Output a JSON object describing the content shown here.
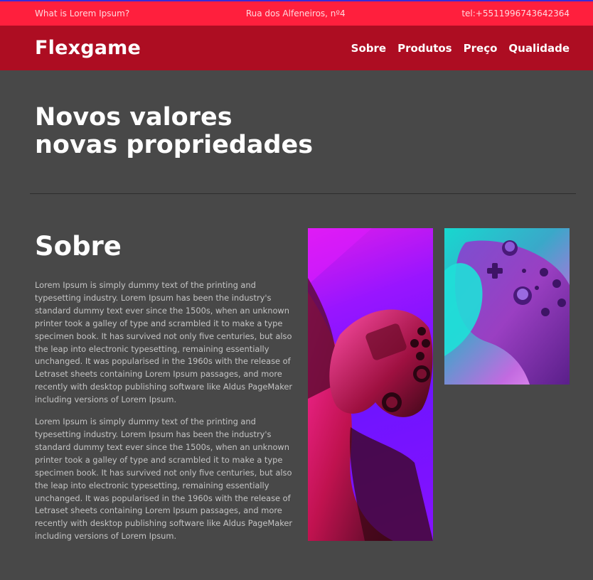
{
  "topbar": {
    "question": "What is Lorem Ipsum?",
    "address": "Rua dos Alfeneiros, nº4",
    "phone": "tel:+5511996743642364"
  },
  "navbar": {
    "brand": "Flexgame",
    "links": [
      "Sobre",
      "Produtos",
      "Preço",
      "Qualidade"
    ]
  },
  "hero": {
    "line1": "Novos valores",
    "line2": "novas propriedades"
  },
  "about": {
    "title": "Sobre",
    "paragraphs": [
      "Lorem Ipsum is simply dummy text of the printing and typesetting industry. Lorem Ipsum has been the industry's standard dummy text ever since the 1500s, when an unknown printer took a galley of type and scrambled it to make a type specimen book. It has survived not only five centuries, but also the leap into electronic typesetting, remaining essentially unchanged. It was popularised in the 1960s with the release of Letraset sheets containing Lorem Ipsum passages, and more recently with desktop publishing software like Aldus PageMaker including versions of Lorem Ipsum.",
      "Lorem Ipsum is simply dummy text of the printing and typesetting industry. Lorem Ipsum has been the industry's standard dummy text ever since the 1500s, when an unknown printer took a galley of type and scrambled it to make a type specimen book. It has survived not only five centuries, but also the leap into electronic typesetting, remaining essentially unchanged. It was popularised in the 1960s with the release of Letraset sheets containing Lorem Ipsum passages, and more recently with desktop publishing software like Aldus PageMaker including versions of Lorem Ipsum."
    ]
  },
  "images": {
    "tall": "hand-holding-gamepad-photo",
    "small": "gamepad-closeup-photo"
  },
  "colors": {
    "topbar": "#ff1f3d",
    "navbar": "#ad0d22",
    "background": "#484848"
  }
}
